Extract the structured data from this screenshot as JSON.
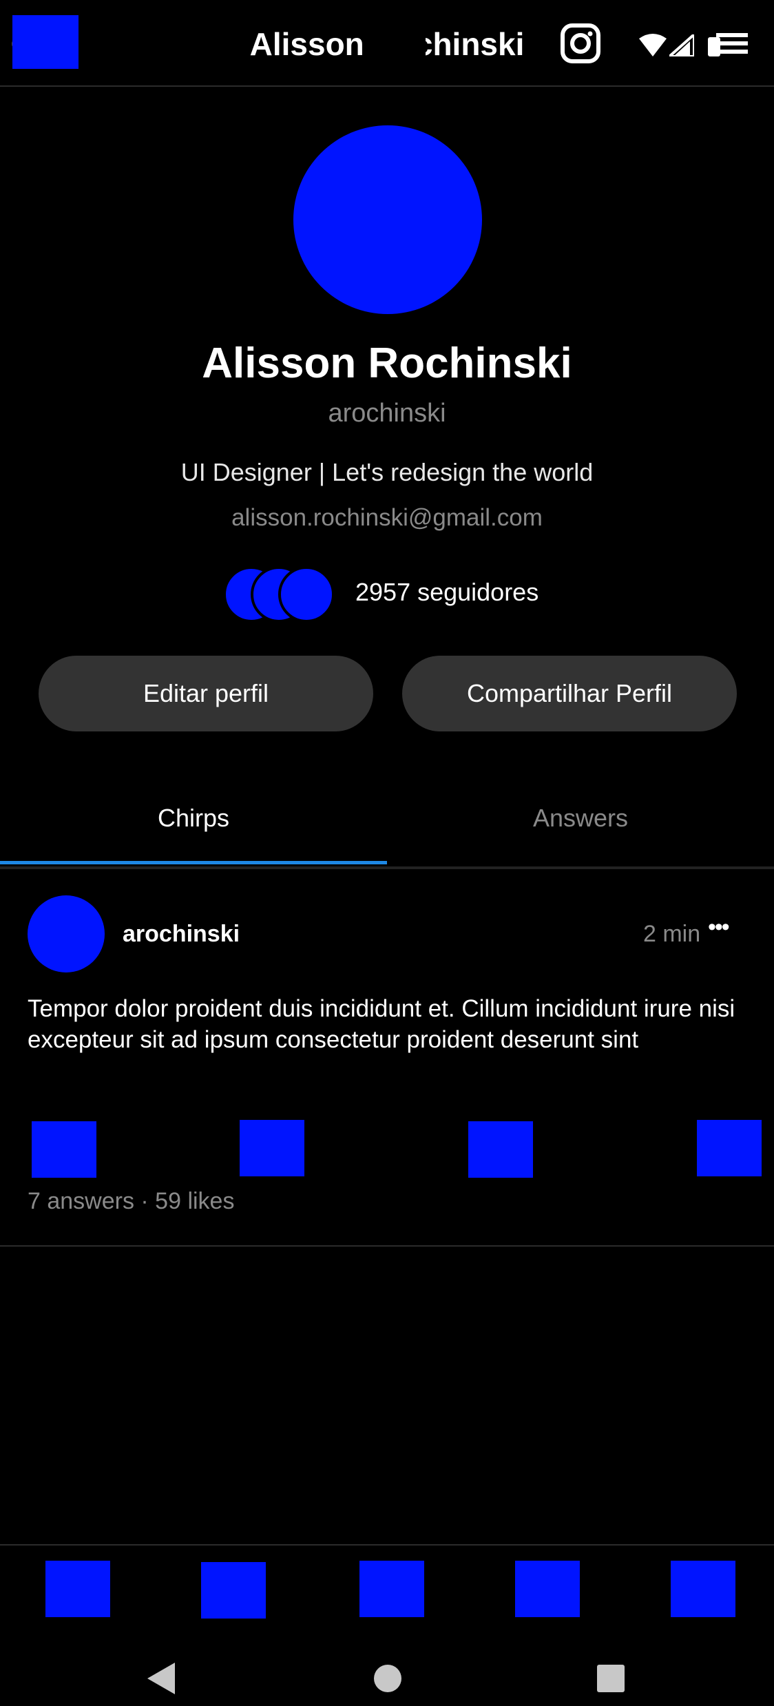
{
  "status_bar": {
    "time_visible": "6"
  },
  "header": {
    "title": "Alisson Rochinski"
  },
  "profile": {
    "name": "Alisson Rochinski",
    "username": "arochinski",
    "bio": "UI Designer | Let's redesign the world",
    "email": "alisson.rochinski@gmail.com",
    "followers_text": "2957 seguidores"
  },
  "actions": {
    "edit_label": "Editar perfil",
    "share_label": "Compartilhar Perfil"
  },
  "tabs": [
    {
      "label": "Chirps",
      "active": true
    },
    {
      "label": "Answers",
      "active": false
    }
  ],
  "post": {
    "author": "arochinski",
    "time": "2 min",
    "more_label": "•••",
    "body": "Tempor dolor proident duis incididunt et. Cillum incididunt irure nisi excepteur sit ad ipsum consectetur proident deserunt sint",
    "stats": "7 answers · 59 likes"
  },
  "icons": {
    "top_left": "app-icon",
    "instagram": "instagram-icon",
    "wifi": "wifi-icon",
    "signal": "signal-icon",
    "battery": "battery-icon",
    "post_actions": [
      "like-icon",
      "comment-icon",
      "repost-icon",
      "share-icon"
    ],
    "bottom_nav": [
      "home-icon",
      "search-icon",
      "compose-icon",
      "notifications-icon",
      "profile-icon"
    ]
  },
  "colors": {
    "background": "#000000",
    "placeholder_blue": "#0014ff",
    "accent": "#1e88e5",
    "button_bg": "#333333",
    "muted_text": "#8a8a8a"
  }
}
